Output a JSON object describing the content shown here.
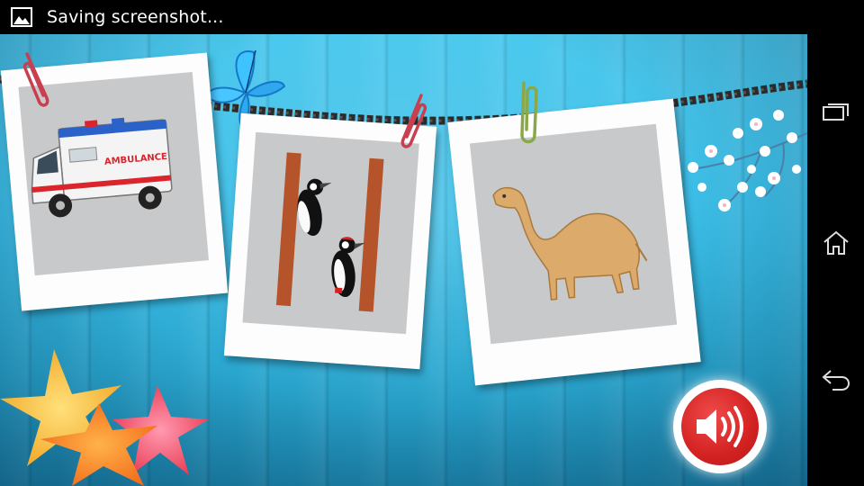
{
  "status_bar": {
    "notification_text": "Saving screenshot...",
    "icon": "image-icon"
  },
  "navigation_bar": {
    "buttons": [
      {
        "name": "recent-apps",
        "icon": "recent-apps-icon"
      },
      {
        "name": "home",
        "icon": "home-icon"
      },
      {
        "name": "back",
        "icon": "back-icon"
      }
    ]
  },
  "cards": [
    {
      "subject": "ambulance",
      "text": "AMBULANCE"
    },
    {
      "subject": "woodpecker",
      "text": ""
    },
    {
      "subject": "camel",
      "text": ""
    }
  ],
  "sound_button": {
    "icon": "speaker-icon"
  },
  "colors": {
    "background": "#3bbde6",
    "sound_button": "#d32222",
    "frame": "#fdfdfd"
  }
}
